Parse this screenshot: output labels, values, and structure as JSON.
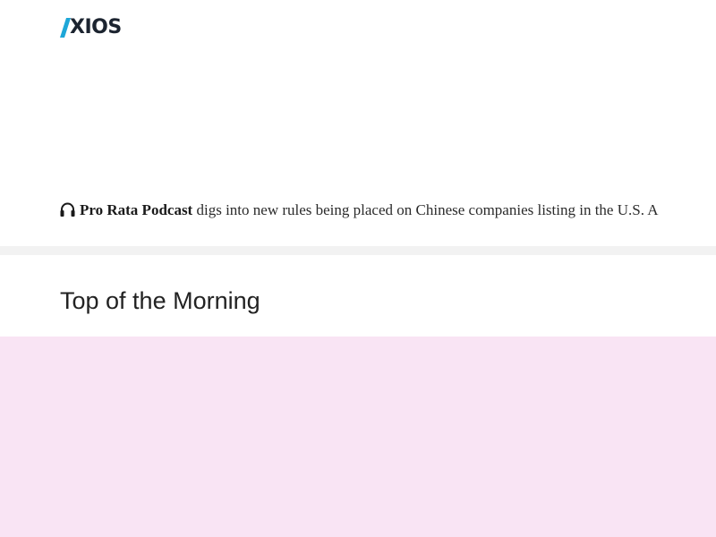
{
  "header": {
    "logo_text": "XIOS",
    "logo_icon": "axios-a-mark-icon",
    "accent_color": "#1ea7d8"
  },
  "podcast": {
    "icon": "headphones-icon",
    "name": "Pro Rata Podcast",
    "text": " digs into new rules being placed on Chinese companies listing in the U.S. A"
  },
  "section": {
    "title": "Top of the Morning"
  },
  "ad": {
    "background_color": "#f9e4f4"
  }
}
